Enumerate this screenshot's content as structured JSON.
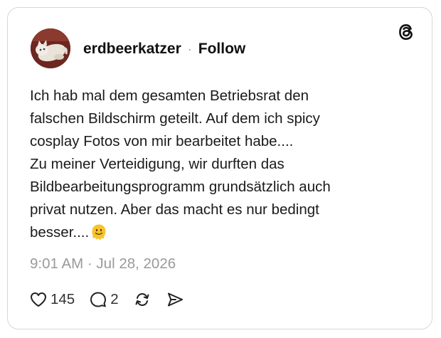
{
  "post": {
    "author": {
      "username": "erdbeerkatzer",
      "separator": "·",
      "follow_label": "Follow",
      "avatar_icon": "cat-avatar"
    },
    "text": "Ich hab mal dem gesamten Betriebsrat den\nfalschen Bildschirm geteilt. Auf dem ich spicy\ncosplay Fotos von mir bearbeitet habe....\nZu meiner Verteidigung, wir durften das\nBildbearbeitungsprogramm grundsätzlich auch\nprivat nutzen. Aber das macht es nur bedingt\nbesser....",
    "emoji": "melting-face-emoji",
    "timestamp": "9:01 AM · Jul 28, 2026",
    "actions": {
      "like_icon": "heart-icon",
      "like_count": "145",
      "reply_icon": "comment-icon",
      "reply_count": "2",
      "repost_icon": "repost-icon",
      "share_icon": "share-icon"
    }
  },
  "brand": {
    "logo_icon": "threads-logo-icon"
  },
  "colors": {
    "text": "#1a1a1a",
    "muted": "#9a9a9a",
    "border": "#d6d6d6"
  }
}
